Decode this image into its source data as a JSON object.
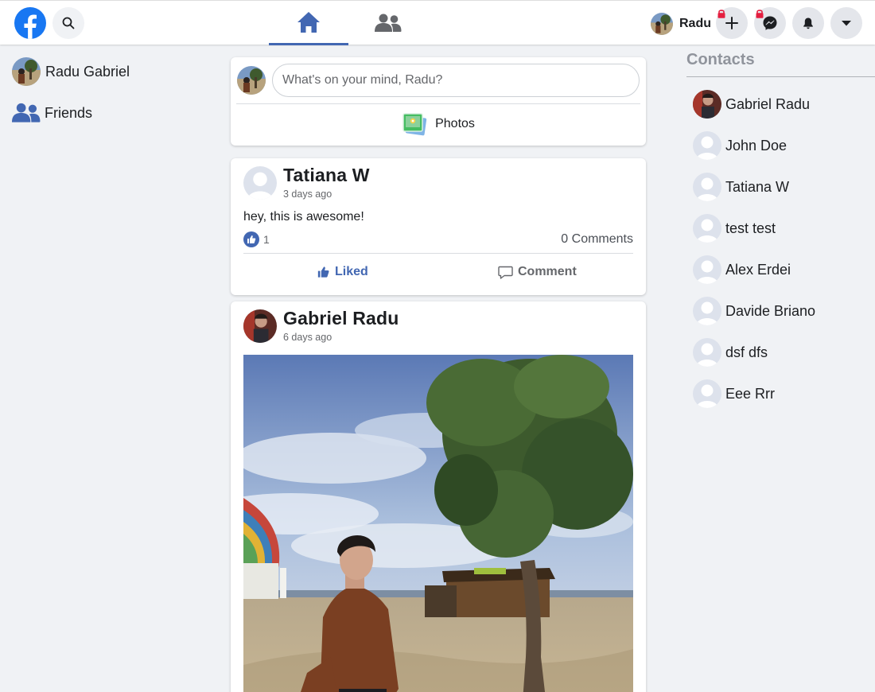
{
  "user": {
    "short_name": "Radu",
    "full_name": "Radu Gabriel"
  },
  "nav": {
    "tabs": [
      {
        "icon": "home-icon",
        "active": true
      },
      {
        "icon": "friends-icon",
        "active": false
      }
    ],
    "buttons": [
      "create-plus-icon",
      "messenger-icon",
      "bell-icon",
      "caret-down-icon"
    ]
  },
  "sidebar": {
    "items": [
      {
        "label": "Radu Gabriel",
        "icon": "avatar"
      },
      {
        "label": "Friends",
        "icon": "friends-icon"
      }
    ]
  },
  "composer": {
    "placeholder": "What's on your mind, Radu?",
    "photos_label": "Photos"
  },
  "posts": [
    {
      "author": "Tatiana W",
      "time": "3 days ago",
      "text": "hey, this is awesome!",
      "likes": "1",
      "comments": "0 Comments",
      "like_label": "Liked",
      "comment_label": "Comment"
    },
    {
      "author": "Gabriel Radu",
      "time": "6 days ago",
      "has_photo": true
    }
  ],
  "contacts": {
    "title": "Contacts",
    "items": [
      {
        "name": "Gabriel Radu",
        "has_photo": true
      },
      {
        "name": "John Doe",
        "has_photo": false
      },
      {
        "name": "Tatiana W",
        "has_photo": false
      },
      {
        "name": "test test",
        "has_photo": false
      },
      {
        "name": "Alex Erdei",
        "has_photo": false
      },
      {
        "name": "Davide Briano",
        "has_photo": false
      },
      {
        "name": "dsf dfs",
        "has_photo": false
      },
      {
        "name": "Eee Rrr",
        "has_photo": false
      }
    ]
  },
  "colors": {
    "brand": "#1877f2",
    "accent": "#4267b2",
    "background": "#f0f2f5",
    "lock": "#e41e3f"
  }
}
